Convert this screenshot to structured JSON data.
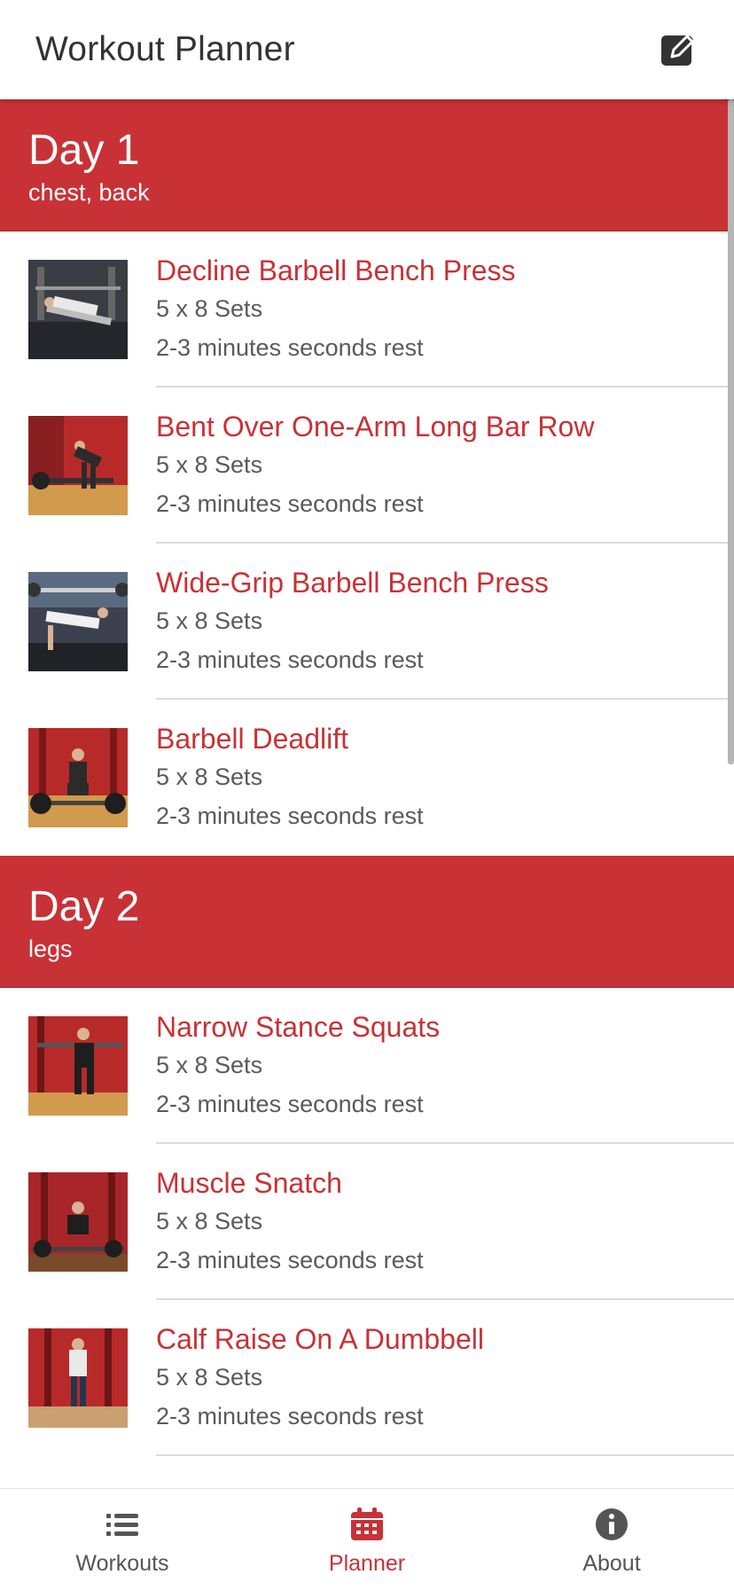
{
  "header": {
    "title": "Workout Planner",
    "edit_icon": "edit-icon"
  },
  "colors": {
    "accent": "#c83236",
    "text": "#555555",
    "header_text": "#333333"
  },
  "days": [
    {
      "title": "Day 1",
      "subtitle": "chest, back",
      "exercises": [
        {
          "name": "Decline Barbell Bench Press",
          "sets": "5 x 8 Sets",
          "rest": "2-3 minutes seconds rest"
        },
        {
          "name": "Bent Over One-Arm Long Bar Row",
          "sets": "5 x 8 Sets",
          "rest": "2-3 minutes seconds rest"
        },
        {
          "name": "Wide-Grip Barbell Bench Press",
          "sets": "5 x 8 Sets",
          "rest": "2-3 minutes seconds rest"
        },
        {
          "name": "Barbell Deadlift",
          "sets": "5 x 8 Sets",
          "rest": "2-3 minutes seconds rest"
        }
      ]
    },
    {
      "title": "Day 2",
      "subtitle": "legs",
      "exercises": [
        {
          "name": "Narrow Stance Squats",
          "sets": "5 x 8 Sets",
          "rest": "2-3 minutes seconds rest"
        },
        {
          "name": "Muscle Snatch",
          "sets": "5 x 8 Sets",
          "rest": "2-3 minutes seconds rest"
        },
        {
          "name": "Calf Raise On A Dumbbell",
          "sets": "5 x 8 Sets",
          "rest": "2-3 minutes seconds rest"
        }
      ]
    }
  ],
  "tabs": [
    {
      "label": "Workouts",
      "icon": "list-icon",
      "active": false
    },
    {
      "label": "Planner",
      "icon": "calendar-icon",
      "active": true
    },
    {
      "label": "About",
      "icon": "info-icon",
      "active": false
    }
  ]
}
